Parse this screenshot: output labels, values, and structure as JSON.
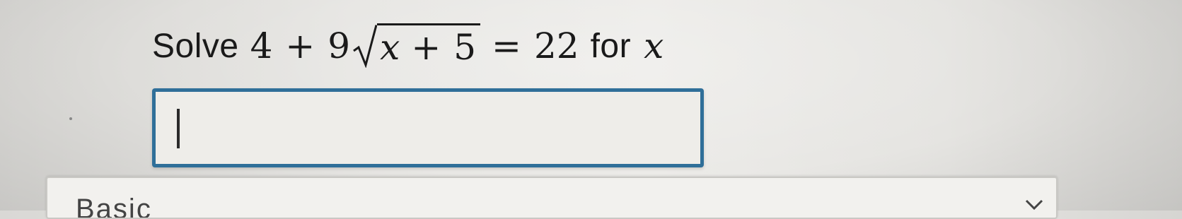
{
  "question": {
    "prefix": "Solve",
    "equation": {
      "lhs_constant": "4",
      "plus_1": "+",
      "coefficient": "9",
      "radicand_var": "x",
      "plus_2": "+",
      "radicand_constant": "5",
      "equals": "=",
      "rhs": "22"
    },
    "middle": "for",
    "variable": "x"
  },
  "answer": {
    "value": ""
  },
  "palette": {
    "label": "Basic"
  },
  "colors": {
    "input_border": "#2f6f99",
    "text": "#1a1a1a"
  }
}
